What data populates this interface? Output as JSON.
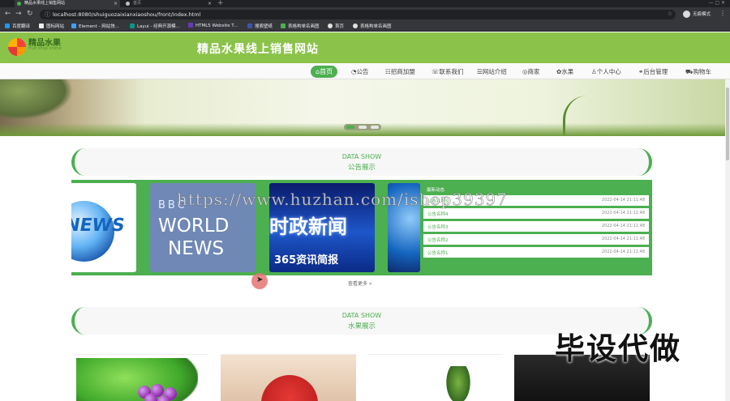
{
  "browser": {
    "tabs": [
      {
        "title": "精品水果线上销售网站",
        "active": true
      },
      {
        "title": "首页",
        "active": false
      }
    ],
    "new_tab": "+",
    "url": "localhost:8080/shuiguozaixianxiaoshou/front/index.html",
    "profile_label": "无痕模式",
    "bookmarks": [
      "百度翻译",
      "图标网站",
      "Element - 网站快...",
      "Layui - 经典开源模...",
      "HTML5 Website T...",
      "搜索壁纸",
      "表格构单名画图",
      "首页",
      "表格构单名画图"
    ]
  },
  "site": {
    "logo_text": "精品水果",
    "logo_sub": "fruit shop online",
    "title": "精品水果线上销售网站"
  },
  "nav": [
    {
      "icon": "home-icon",
      "label": "首页",
      "active": true
    },
    {
      "icon": "notice-icon",
      "label": "公告"
    },
    {
      "icon": "join-icon",
      "label": "招商加盟"
    },
    {
      "icon": "contact-icon",
      "label": "联系我们"
    },
    {
      "icon": "about-icon",
      "label": "网站介绍"
    },
    {
      "icon": "merchant-icon",
      "label": "商家"
    },
    {
      "icon": "fruit-icon",
      "label": "水果"
    },
    {
      "icon": "user-icon",
      "label": "个人中心"
    },
    {
      "icon": "link-icon",
      "label": "后台管理"
    },
    {
      "icon": "cart-icon",
      "label": "购物车"
    }
  ],
  "sections": {
    "notice": {
      "en": "DATA SHOW",
      "cn": "公告展示"
    },
    "fruit": {
      "en": "DATA SHOW",
      "cn": "水果展示"
    }
  },
  "notice_cards": {
    "card1_text": "NEWS",
    "card2_line1": "BBC",
    "card2_line2": "WORLD",
    "card2_line3": "NEWS",
    "card3_line1": "时政新闻",
    "card3_line2": "365资讯简报"
  },
  "notice_list": {
    "head": "最新动态",
    "items": [
      {
        "name": "公告名称5",
        "time": "2022-04-14 21:11:48"
      },
      {
        "name": "公告名称4",
        "time": "2022-04-14 21:11:48"
      },
      {
        "name": "公告名称3",
        "time": "2022-04-14 21:11:48"
      },
      {
        "name": "公告名称2",
        "time": "2022-04-14 21:11:48"
      },
      {
        "name": "公告名称1",
        "time": "2022-04-14 21:11:48"
      }
    ]
  },
  "more_link": "查看更多 »",
  "watermarks": {
    "url": "https://www.huzhan.com/ishop39397",
    "cn": "毕设代做"
  },
  "colors": {
    "brand": "#8bc34a",
    "accent": "#4caf50"
  }
}
